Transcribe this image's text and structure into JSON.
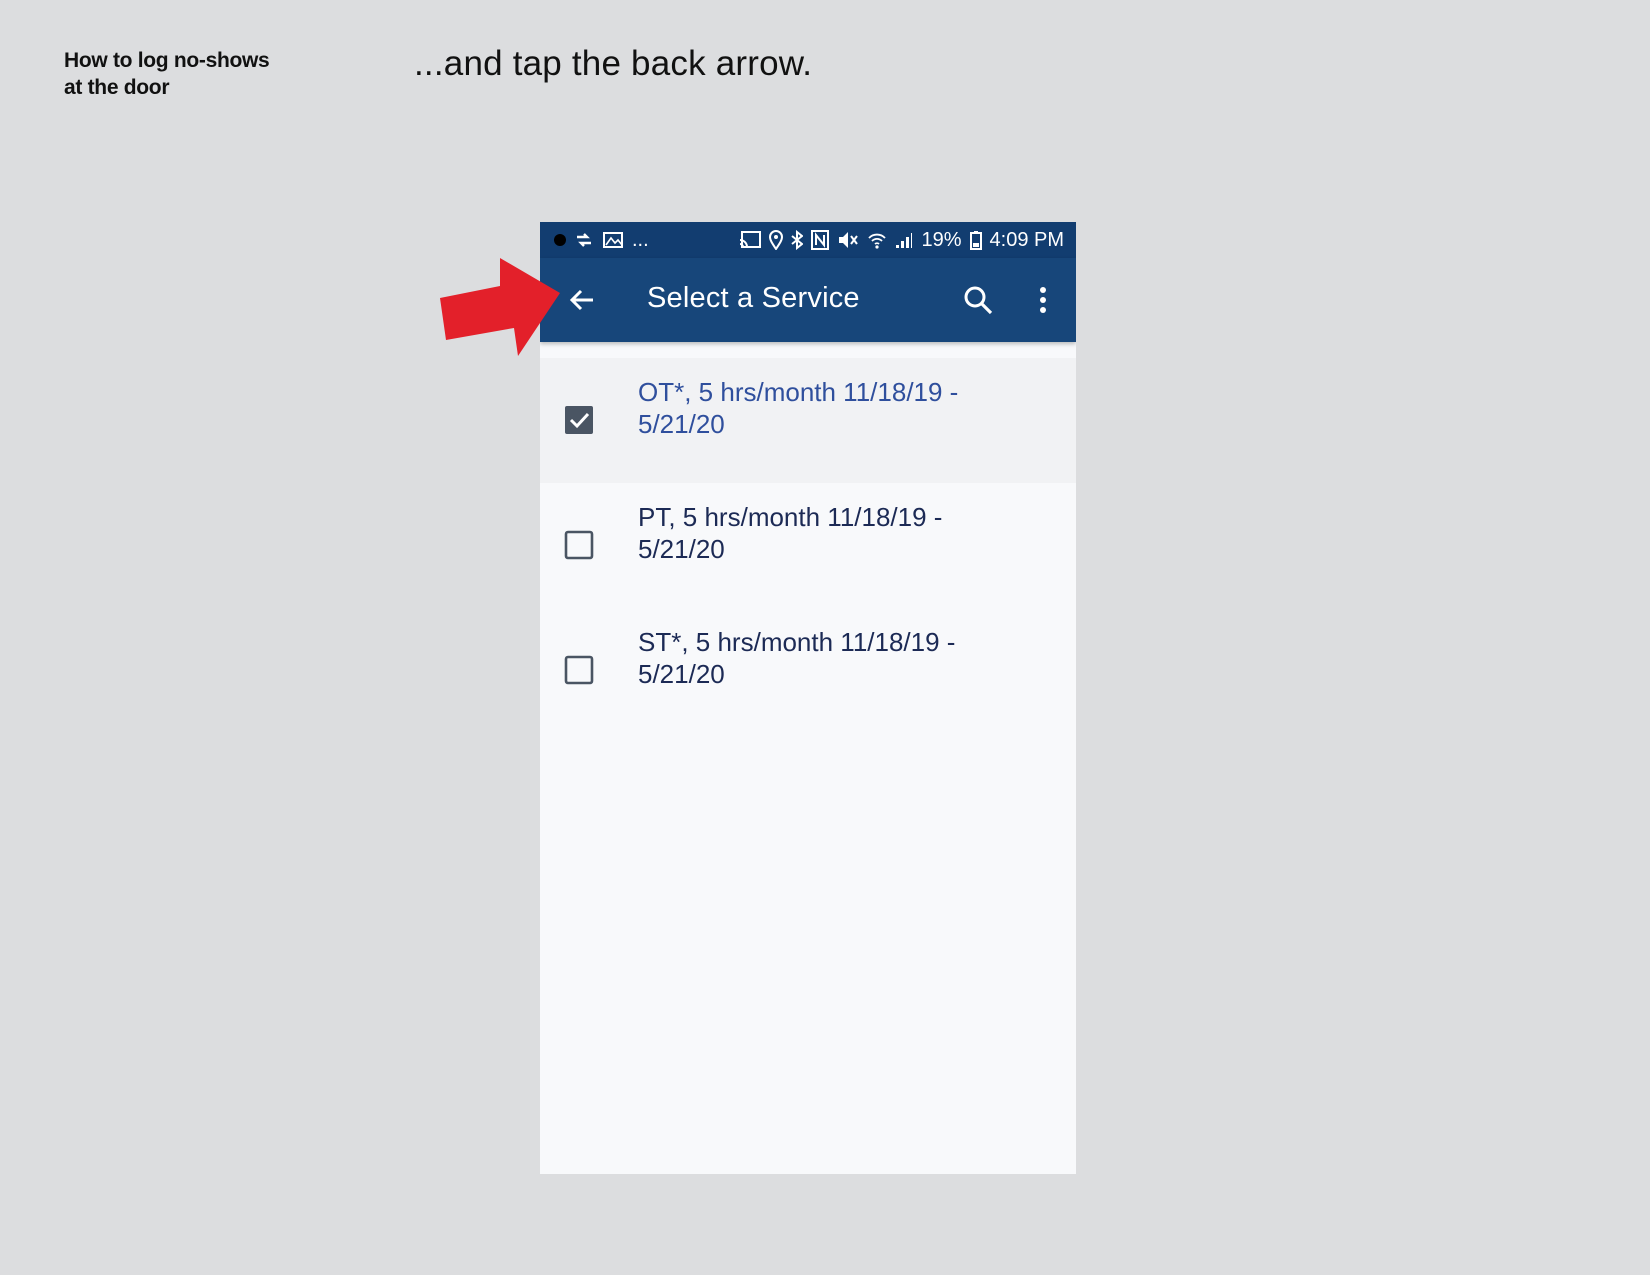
{
  "document": {
    "title_line1": "How to log no-shows",
    "title_line2": "at the door",
    "step_caption": "...and tap the back arrow."
  },
  "statusbar": {
    "left_icons": [
      "notification-dot-icon",
      "sync-icon",
      "gallery-icon"
    ],
    "overflow": "...",
    "right_icons": [
      "cast-icon",
      "location-icon",
      "bluetooth-icon",
      "nfc-icon",
      "mute-icon",
      "wifi-icon",
      "signal-icon",
      "battery-icon"
    ],
    "battery": "19%",
    "time": "4:09 PM"
  },
  "appbar": {
    "title": "Select a Service",
    "icons": [
      "back-arrow-icon",
      "search-icon",
      "more-vert-icon"
    ]
  },
  "services": [
    {
      "line1": "OT*, 5 hrs/month 11/18/19 -",
      "line2": "5/21/20",
      "checked": true
    },
    {
      "line1": "PT, 5 hrs/month 11/18/19 -",
      "line2": "5/21/20",
      "checked": false
    },
    {
      "line1": "ST*, 5 hrs/month 11/18/19 -",
      "line2": "5/21/20",
      "checked": false
    }
  ],
  "colors": {
    "statusbar": "#123d70",
    "appbar": "#17467a",
    "pointer_arrow": "#e3202a",
    "selected_text": "#2f4f9d",
    "checkbox": "#4a5563"
  }
}
